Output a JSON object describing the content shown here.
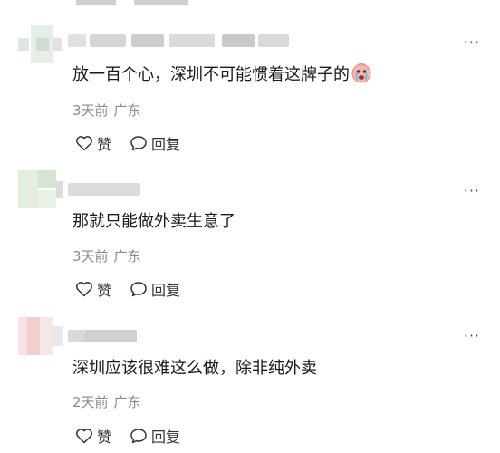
{
  "comments": [
    {
      "content": "放一百个心，深圳不可能惯着这牌子的",
      "time": "3天前",
      "location": "广东",
      "like_label": "赞",
      "reply_label": "回复"
    },
    {
      "content": "那就只能做外卖生意了",
      "time": "3天前",
      "location": "广东",
      "like_label": "赞",
      "reply_label": "回复"
    },
    {
      "content": "深圳应该很难这么做，除非纯外卖",
      "time": "2天前",
      "location": "广东",
      "like_label": "赞",
      "reply_label": "回复"
    }
  ],
  "more_glyph": "···",
  "icons": {
    "like": "heart-outline-icon",
    "reply": "speech-bubble-icon",
    "emoji": "crying-face-emoji"
  }
}
